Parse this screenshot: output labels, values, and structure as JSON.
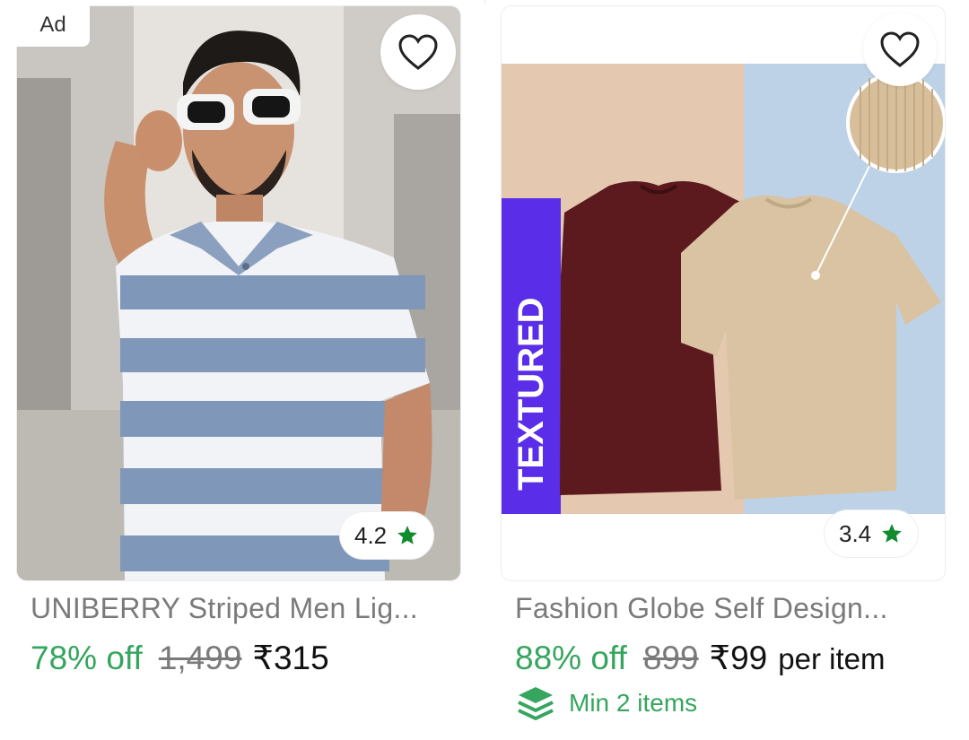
{
  "card1": {
    "ad_label": "Ad",
    "rating": "4.2",
    "title": "UNIBERRY Striped Men Lig...",
    "discount": "78% off",
    "mrp": "1,499",
    "price": "₹315",
    "wishlist_icon": "heart-outline-icon",
    "rating_icon": "star-icon"
  },
  "card2": {
    "rating": "3.4",
    "image_text": "TEXTURED",
    "title": "Fashion Globe Self Design...",
    "discount": "88% off",
    "mrp": "899",
    "price": "₹99",
    "price_unit": "per item",
    "min_items": "Min 2 items",
    "wishlist_icon": "heart-outline-icon",
    "rating_icon": "star-icon",
    "min_items_icon": "stack-layers-icon"
  },
  "colors": {
    "discount_green": "#36a55e",
    "star_green": "#128a2e",
    "muted_text": "#7a7a7a"
  }
}
